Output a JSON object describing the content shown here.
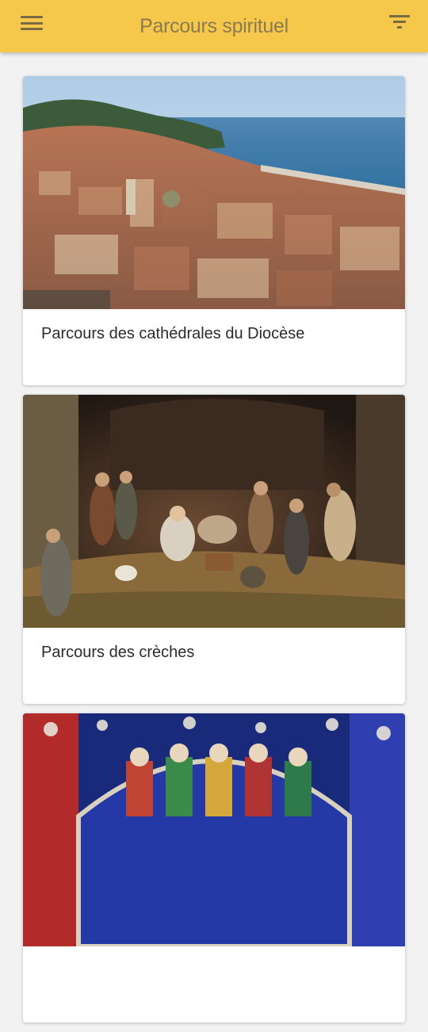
{
  "app_bar": {
    "title": "Parcours spirituel",
    "menu_icon": "hamburger-menu-icon",
    "filter_icon": "filter-list-icon",
    "color": "#f5c84c"
  },
  "cards": [
    {
      "title": "Parcours des cathédrales du Diocèse",
      "image": "aerial city view by the sea"
    },
    {
      "title": "Parcours des crèches",
      "image": "nativity scene figurines"
    },
    {
      "title": "",
      "image": "stained glass window"
    }
  ]
}
